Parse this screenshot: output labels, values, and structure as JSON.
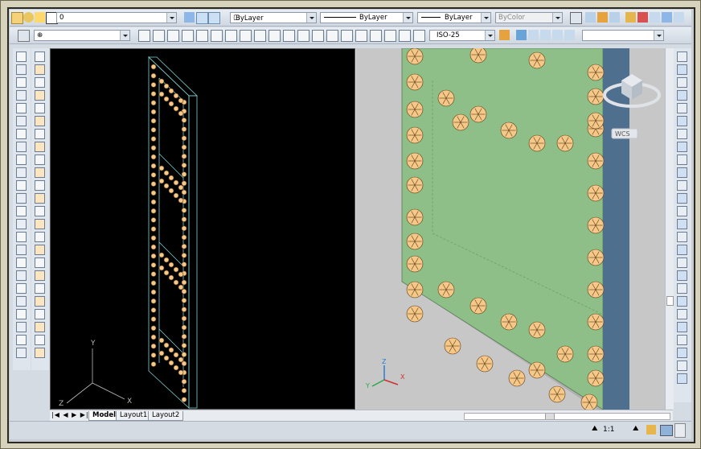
{
  "layer_combo": {
    "value": "0"
  },
  "color_combo": {
    "value": "ByLayer"
  },
  "linetype_combo": {
    "value": "ByLayer"
  },
  "lineweight_combo": {
    "value": "ByLayer"
  },
  "plotstyle_combo": {
    "value": "ByColor"
  },
  "dimstyle_combo": {
    "value": "ISO-25"
  },
  "viewcube": {
    "wcs_label": "WCS"
  },
  "ucs_left": {
    "x": "X",
    "y": "Y",
    "z": "Z"
  },
  "ucs_right": {
    "x": "X",
    "y": "Y",
    "z": "Z"
  },
  "tabs": [
    {
      "label": "Model"
    },
    {
      "label": "Layout1"
    },
    {
      "label": "Layout2"
    }
  ],
  "status": {
    "annotation_scale": "1:1"
  },
  "colors": {
    "model_bg": "#000000",
    "render_bg": "#c7c7c7",
    "panel_green": "#8fbf88",
    "panel_side": "#4f6f8f",
    "bolt": "#f5c88a"
  }
}
